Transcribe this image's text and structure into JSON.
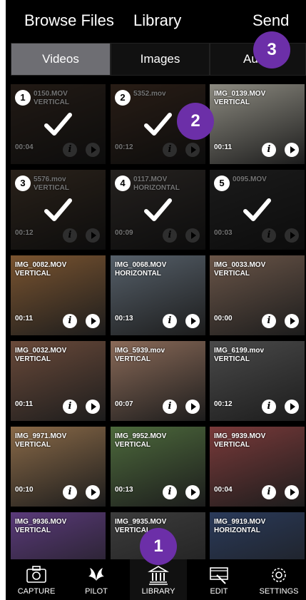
{
  "header": {
    "browse": "Browse Files",
    "library": "Library",
    "send": "Send"
  },
  "segments": [
    "Videos",
    "Images",
    "Au"
  ],
  "tabs": [
    "CAPTURE",
    "PILOT",
    "LIBRARY",
    "EDIT",
    "SETTINGS"
  ],
  "badges": [
    "1",
    "2",
    "3"
  ],
  "clips": [
    {
      "name": "0150.MOV",
      "orient": "VERTICAL",
      "dur": "00:04",
      "sel": "1",
      "color": "#4b3a2e"
    },
    {
      "name": "5352.mov",
      "orient": "",
      "dur": "00:12",
      "sel": "2",
      "color": "#5a4030"
    },
    {
      "name": "IMG_0139.MOV",
      "orient": "VERTICAL",
      "dur": "00:11",
      "sel": "",
      "color": "#8c8a80"
    },
    {
      "name": "5576.mov",
      "orient": "VERTICAL",
      "dur": "00:12",
      "sel": "3",
      "color": "#5d4b3a"
    },
    {
      "name": "0117.MOV",
      "orient": "HORIZONTAL",
      "dur": "00:09",
      "sel": "4",
      "color": "#524a45"
    },
    {
      "name": "0095.MOV",
      "orient": "",
      "dur": "00:03",
      "sel": "5",
      "color": "#3c3c3c"
    },
    {
      "name": "IMG_0082.MOV",
      "orient": "VERTICAL",
      "dur": "00:11",
      "sel": "",
      "color": "#7a5430"
    },
    {
      "name": "IMG_0068.MOV",
      "orient": "HORIZONTAL",
      "dur": "00:13",
      "sel": "",
      "color": "#56606a"
    },
    {
      "name": "IMG_0033.MOV",
      "orient": "VERTICAL",
      "dur": "00:00",
      "sel": "",
      "color": "#6a5548"
    },
    {
      "name": "IMG_0032.MOV",
      "orient": "VERTICAL",
      "dur": "00:11",
      "sel": "",
      "color": "#6a4a3a"
    },
    {
      "name": "IMG_5939.mov",
      "orient": "VERTICAL",
      "dur": "00:07",
      "sel": "",
      "color": "#8a6a58"
    },
    {
      "name": "IMG_6199.mov",
      "orient": "VERTICAL",
      "dur": "00:12",
      "sel": "",
      "color": "#4a4a4a"
    },
    {
      "name": "IMG_9971.MOV",
      "orient": "VERTICAL",
      "dur": "00:10",
      "sel": "",
      "color": "#8a6a48"
    },
    {
      "name": "IMG_9952.MOV",
      "orient": "VERTICAL",
      "dur": "00:13",
      "sel": "",
      "color": "#4d6a3c"
    },
    {
      "name": "IMG_9939.MOV",
      "orient": "VERTICAL",
      "dur": "00:04",
      "sel": "",
      "color": "#7a3a3a"
    },
    {
      "name": "IMG_9936.MOV",
      "orient": "VERTICAL",
      "dur": "",
      "sel": "",
      "color": "#5a3a7a"
    },
    {
      "name": "IMG_9935.MOV",
      "orient": "VERTICAL",
      "dur": "",
      "sel": "",
      "color": "#3c3c3c"
    },
    {
      "name": "IMG_9919.MOV",
      "orient": "HORIZONTAL",
      "dur": "",
      "sel": "",
      "color": "#2a3a5a"
    }
  ]
}
